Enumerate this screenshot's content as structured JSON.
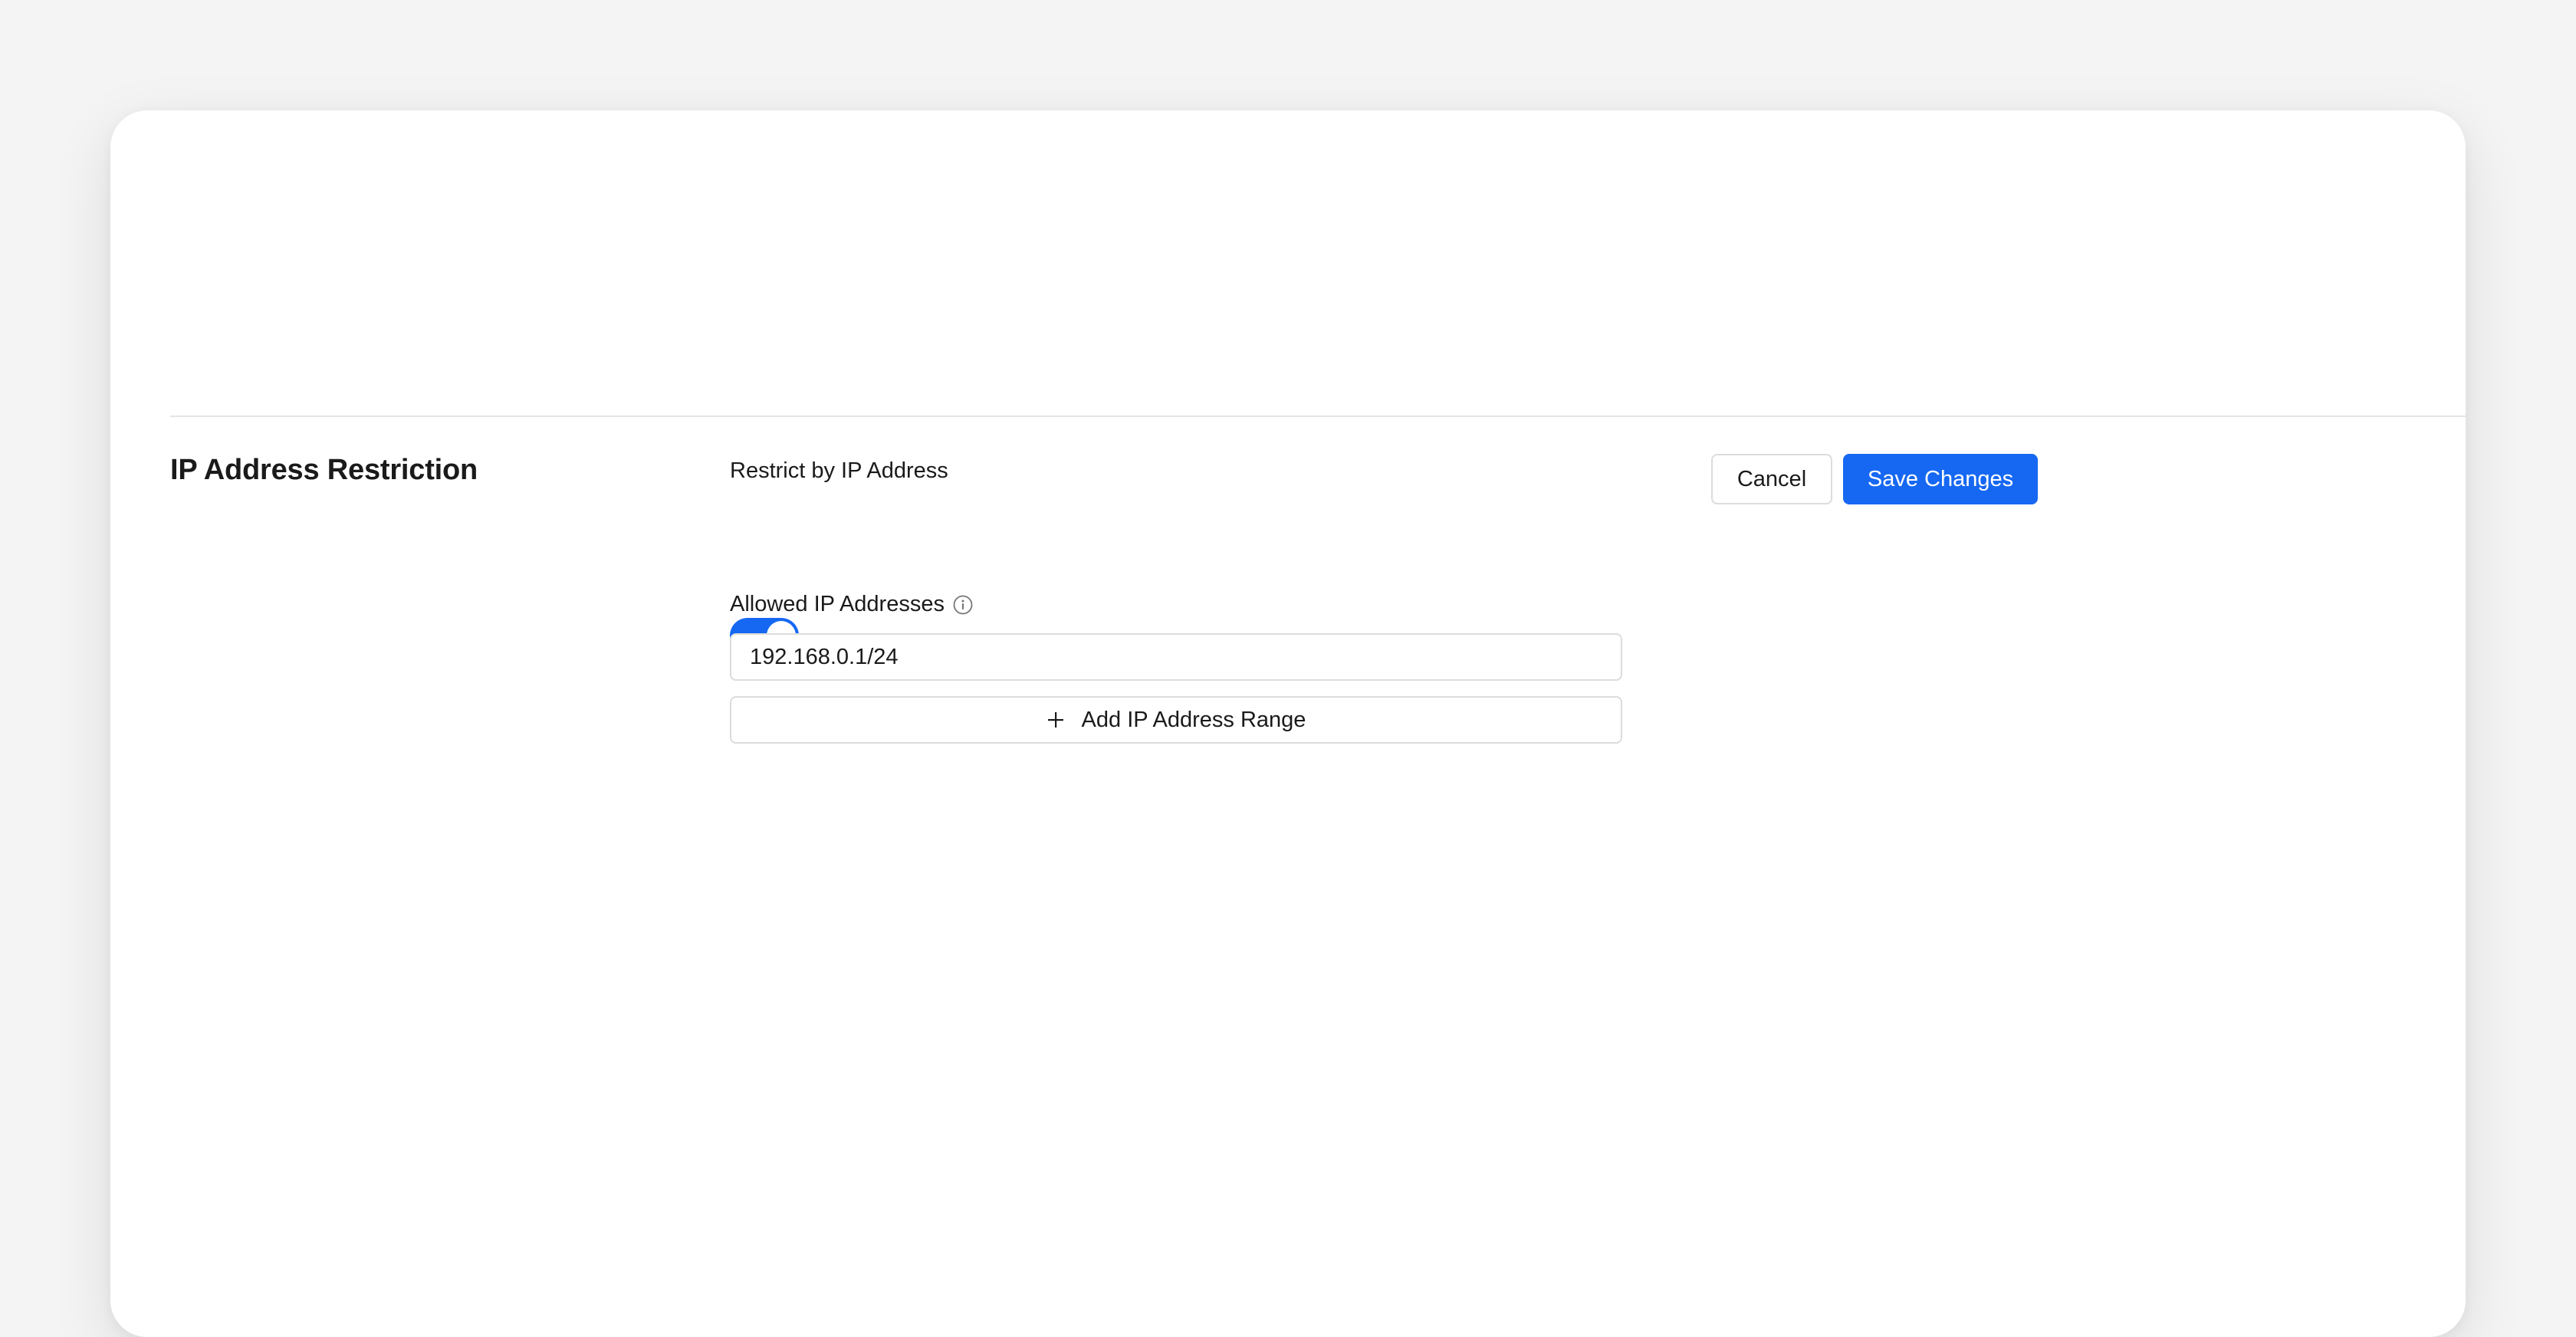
{
  "section": {
    "title": "IP Address Restriction"
  },
  "restrict_toggle": {
    "label": "Restrict by IP Address",
    "enabled": true
  },
  "allowed_ips": {
    "label": "Allowed IP Addresses",
    "info_icon": "info-icon",
    "entries": [
      "192.168.0.1/24"
    ],
    "add_label": "Add IP Address Range",
    "add_icon": "plus-icon"
  },
  "actions": {
    "cancel_label": "Cancel",
    "save_label": "Save Changes"
  },
  "colors": {
    "accent": "#1668f2",
    "border": "#dcdcdc",
    "background": "#f4f4f4"
  }
}
